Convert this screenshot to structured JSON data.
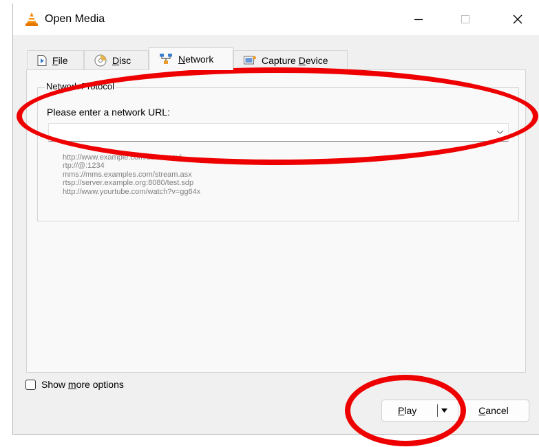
{
  "window": {
    "title": "Open Media",
    "controls": [
      "minimize-icon",
      "maximize-icon",
      "close-icon"
    ]
  },
  "tabs": [
    {
      "label": "File",
      "mnemonic": "F",
      "icon": "file-icon",
      "active": false
    },
    {
      "label": "Disc",
      "mnemonic": "D",
      "icon": "disc-icon",
      "active": false
    },
    {
      "label": "Network",
      "mnemonic": "N",
      "icon": "network-icon",
      "active": true
    },
    {
      "label": "Capture Device",
      "mnemonic": "D",
      "icon": "capture-device-icon",
      "active": false
    }
  ],
  "network": {
    "group_title": "Network Protocol",
    "url_label": "Please enter a network URL:",
    "url_value": "",
    "examples": [
      "http://www.example.com/stream.avi",
      "rtp://@:1234",
      "mms://mms.examples.com/stream.asx",
      "rtsp://server.example.org:8080/test.sdp",
      "http://www.yourtube.com/watch?v=gg64x"
    ]
  },
  "options": {
    "show_more_label": "Show more options",
    "show_more_checked": false
  },
  "buttons": {
    "play_label": "Play",
    "cancel_label": "Cancel"
  },
  "annotations": {
    "color": "#ee0000"
  }
}
